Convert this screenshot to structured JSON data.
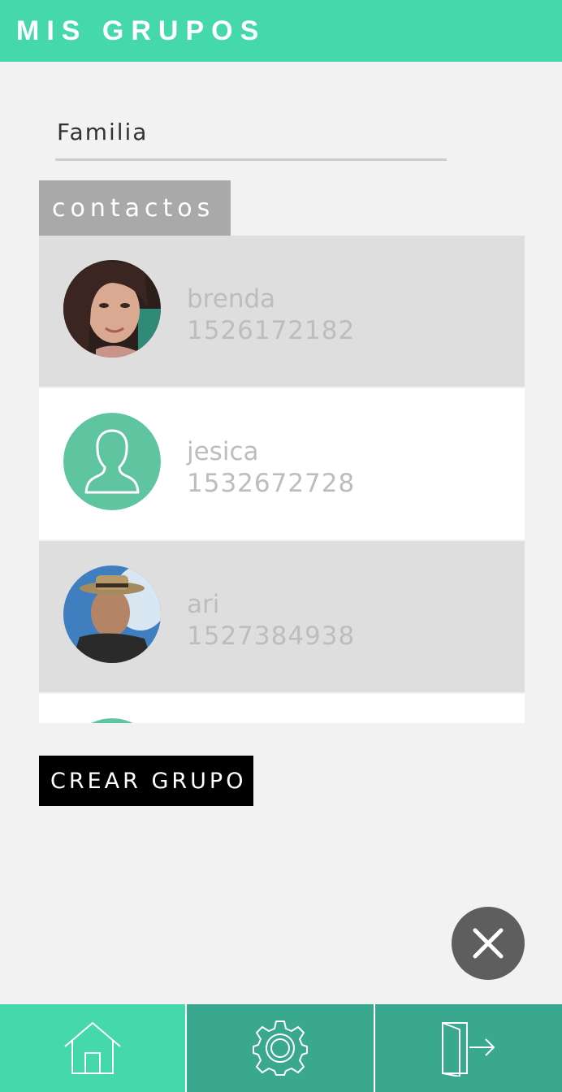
{
  "header": {
    "title": "MIS GRUPOS"
  },
  "group_name": {
    "value": "Familia"
  },
  "contacts_section": {
    "label": "contactos"
  },
  "contacts": [
    {
      "name": "brenda",
      "phone": "1526172182",
      "avatar": "photo-woman"
    },
    {
      "name": "jesica",
      "phone": "1532672728",
      "avatar": "default-user-icon"
    },
    {
      "name": "ari",
      "phone": "1527384938",
      "avatar": "photo-man-hat"
    }
  ],
  "actions": {
    "create_group_label": "CREAR GRUPO",
    "close_icon": "close-icon"
  },
  "bottom_nav": [
    {
      "id": "home",
      "icon": "home-icon",
      "active": true
    },
    {
      "id": "settings",
      "icon": "gear-icon",
      "active": false
    },
    {
      "id": "logout",
      "icon": "logout-icon",
      "active": false
    }
  ],
  "colors": {
    "accent": "#44d8aa",
    "accent_dark": "#3aa78f",
    "avatar_default": "#5fc4a0",
    "row_shaded": "#dedede",
    "text_muted": "#bdbdbd"
  }
}
